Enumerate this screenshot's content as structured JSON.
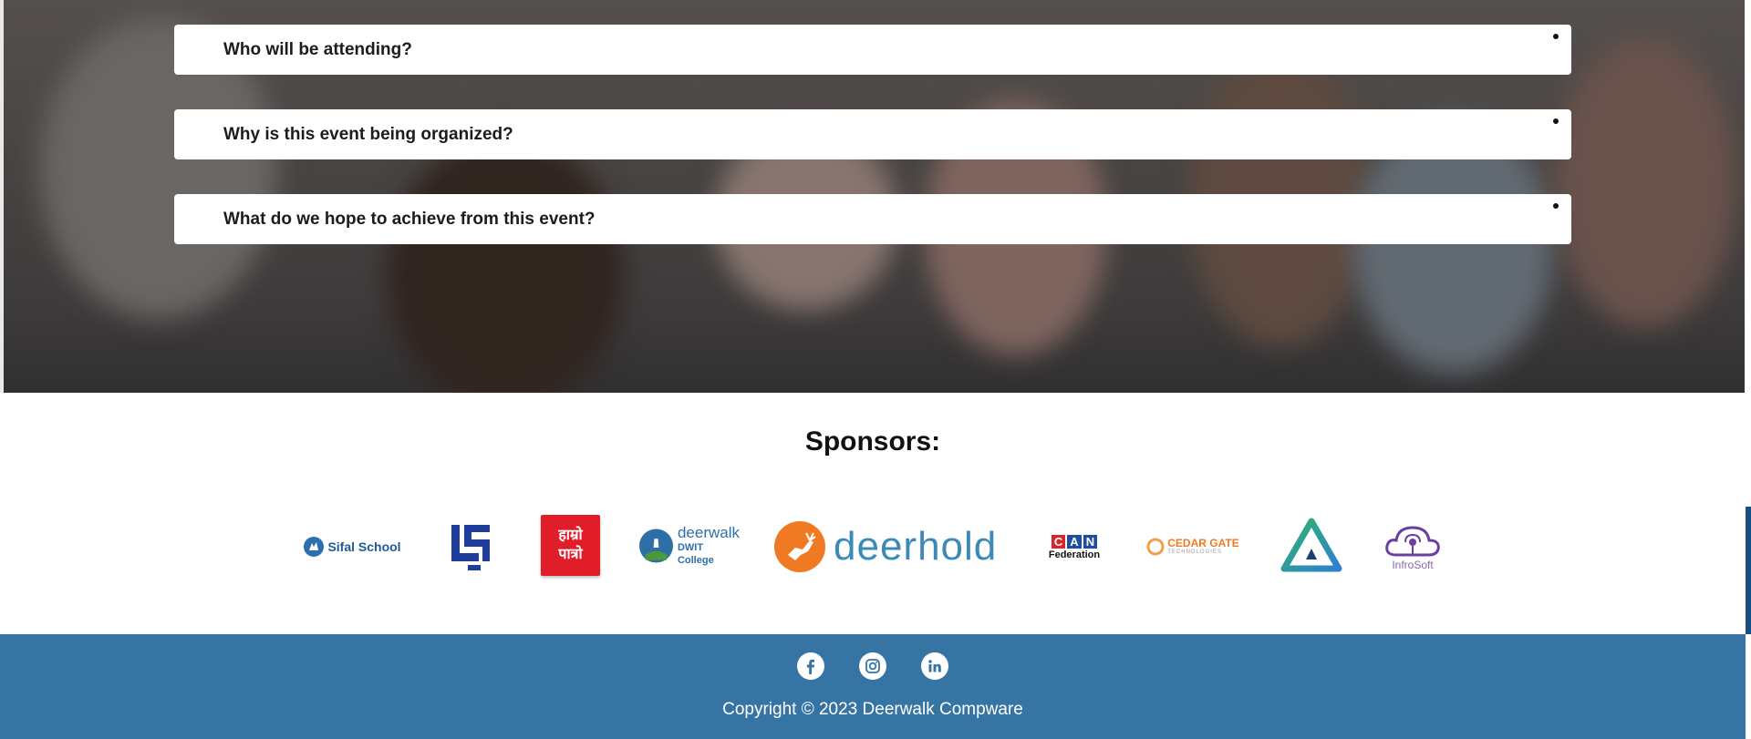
{
  "faq": {
    "items": [
      {
        "question": "Who will be attending?"
      },
      {
        "question": "Why is this event being organized?"
      },
      {
        "question": "What do we hope to achieve from this event?"
      }
    ]
  },
  "sponsors": {
    "title": "Sponsors:",
    "logos": [
      {
        "name": "Sifal School",
        "text": "Sifal School"
      },
      {
        "name": "LS monogram"
      },
      {
        "name": "Hamro Patro",
        "line1": "हाम्रो",
        "line2": "पात्रो"
      },
      {
        "name": "Deerwalk DWIT College",
        "line1": "deerwalk",
        "line2": "DWIT College"
      },
      {
        "name": "deerhold",
        "text": "deerhold"
      },
      {
        "name": "CAN Federation",
        "letters": "CAN",
        "sub": "Federation"
      },
      {
        "name": "Cedar Gate Technologies",
        "text": "CEDAR GATE",
        "sub": "TECHNOLOGIES"
      },
      {
        "name": "Triangle mark"
      },
      {
        "name": "InfroSoft",
        "text": "InfroSoft"
      }
    ]
  },
  "footer": {
    "social": [
      {
        "icon": "facebook-icon"
      },
      {
        "icon": "instagram-icon"
      },
      {
        "icon": "linkedin-icon"
      }
    ],
    "copyright": "Copyright © 2023 Deerwalk Compware"
  },
  "colors": {
    "footer_bg": "#3674a4",
    "hero_overlay": "#4f4b4a",
    "deerhold_orange": "#f07a24",
    "deerhold_blue": "#3d8ab8",
    "hamro_red": "#e11d2a"
  }
}
